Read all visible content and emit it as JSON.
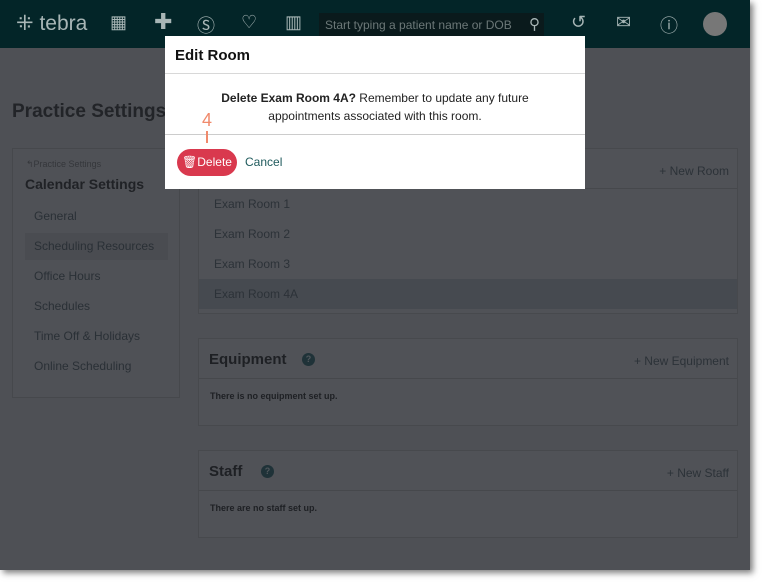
{
  "header": {
    "logo": "tebra",
    "search_placeholder": "Start typing a patient name or DOB",
    "icons": [
      "apps-icon",
      "clinical-icon",
      "billing-icon",
      "patient-engagement-icon",
      "reports-icon",
      "history-icon",
      "mail-icon",
      "help-icon"
    ]
  },
  "page_title": "Practice Settings",
  "sidebar": {
    "breadcrumb": "Practice Settings",
    "heading": "Calendar Settings",
    "items": [
      {
        "label": "General"
      },
      {
        "label": "Scheduling Resources"
      },
      {
        "label": "Office Hours"
      },
      {
        "label": "Schedules"
      },
      {
        "label": "Time Off & Holidays"
      },
      {
        "label": "Online Scheduling"
      }
    ],
    "active": "Scheduling Resources"
  },
  "rooms": {
    "add_label": "New Room",
    "items": [
      "Exam Room 1",
      "Exam Room 2",
      "Exam Room 3",
      "Exam Room 4A"
    ],
    "selected": "Exam Room 4A"
  },
  "equipment": {
    "title": "Equipment",
    "add_label": "New Equipment",
    "empty": "There is no equipment set up."
  },
  "staff": {
    "title": "Staff",
    "add_label": "New Staff",
    "empty": "There are no staff set up."
  },
  "modal": {
    "title": "Edit Room",
    "message_bold": "Delete Exam Room 4A?",
    "message": " Remember to update any future appointments associated with this room.",
    "delete_label": "Delete",
    "cancel_label": "Cancel"
  },
  "annotation": {
    "step": "4",
    "color": "#f08a6c"
  },
  "colors": {
    "header": "#032528",
    "delete": "#d9394e"
  }
}
